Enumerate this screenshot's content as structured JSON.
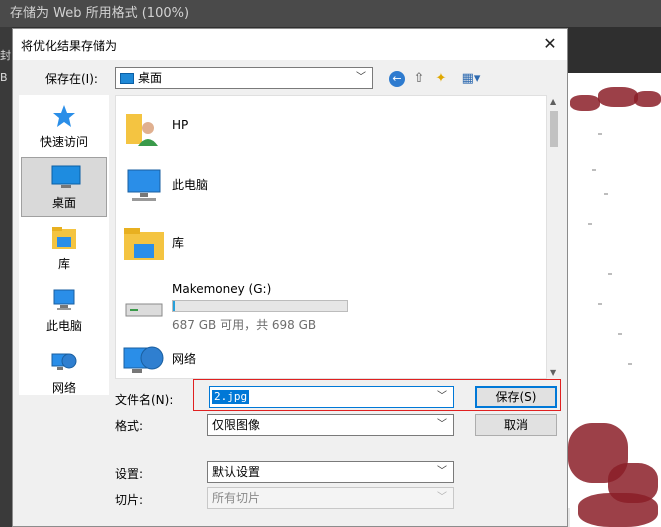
{
  "app": {
    "window_title": "存储为 Web 所用格式 (100%)",
    "left_strip_labels": [
      "封",
      "B"
    ]
  },
  "dialog": {
    "title": "将优化结果存储为",
    "close_glyph": "✕",
    "save_in_label": "保存在(I):",
    "save_in_value": "桌面",
    "toolbar": {
      "back_glyph": "←",
      "up_glyph": "⇧",
      "new_folder_glyph": "✦",
      "view_glyph": "▦▾"
    },
    "places": [
      {
        "label": "快速访问",
        "icon": "star-icon"
      },
      {
        "label": "桌面",
        "icon": "desktop-icon",
        "selected": true
      },
      {
        "label": "库",
        "icon": "library-icon"
      },
      {
        "label": "此电脑",
        "icon": "computer-icon"
      },
      {
        "label": "网络",
        "icon": "network-icon"
      }
    ],
    "items": [
      {
        "name": "HP",
        "icon": "user-folder-icon"
      },
      {
        "name": "此电脑",
        "icon": "computer-icon"
      },
      {
        "name": "库",
        "icon": "library-folder-icon"
      },
      {
        "name": "Makemoney (G:)",
        "icon": "drive-icon",
        "usage": 0.014,
        "sub": "687 GB 可用，共 698 GB"
      },
      {
        "name": "网络",
        "icon": "network-icon"
      }
    ],
    "filename_label": "文件名(N):",
    "filename_value": "2.jpg",
    "format_label": "格式:",
    "format_value": "仅限图像",
    "settings_label": "设置:",
    "settings_value": "默认设置",
    "slices_label": "切片:",
    "slices_value": "所有切片",
    "save_button": "保存(S)",
    "cancel_button": "取消",
    "colors": {
      "accent": "#0078d7",
      "highlight_box": "#e02020",
      "drive_bar": "#26a0da"
    }
  }
}
